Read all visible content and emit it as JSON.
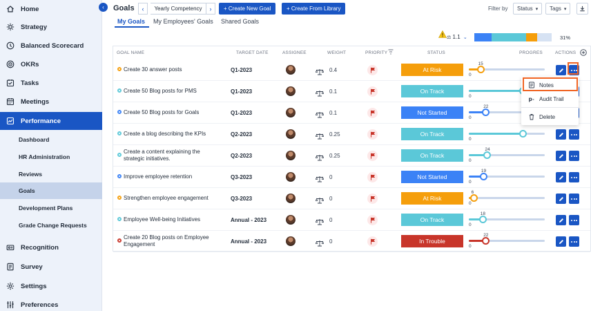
{
  "sidebar": {
    "items": [
      {
        "label": "Home",
        "icon": "home-icon"
      },
      {
        "label": "Strategy",
        "icon": "strategy-icon"
      },
      {
        "label": "Balanced Scorecard",
        "icon": "scorecard-icon"
      },
      {
        "label": "OKRs",
        "icon": "target-icon"
      },
      {
        "label": "Tasks",
        "icon": "tasks-icon"
      },
      {
        "label": "Meetings",
        "icon": "calendar-icon"
      },
      {
        "label": "Performance",
        "icon": "chart-icon"
      }
    ],
    "sub_items": [
      "Dashboard",
      "HR Administration",
      "Reviews",
      "Goals",
      "Development Plans",
      "Grade Change Requests"
    ],
    "bottom_items": [
      {
        "label": "Recognition",
        "icon": "recognition-icon"
      },
      {
        "label": "Survey",
        "icon": "survey-icon"
      },
      {
        "label": "Settings",
        "icon": "gear-icon"
      },
      {
        "label": "Preferences",
        "icon": "sliders-icon"
      }
    ]
  },
  "header": {
    "title": "Goals",
    "competency": "Yearly Competency",
    "create_new": "+ Create New Goal",
    "create_library": "+ Create From Library",
    "filter_by": "Filter by",
    "status_filter": "Status",
    "tags_filter": "Tags"
  },
  "tabs": [
    "My Goals",
    "My Employees' Goals",
    "Shared Goals"
  ],
  "summary": {
    "value": "1.1",
    "percent": "31%",
    "segments": [
      {
        "color": "#3b82f6",
        "fraction": 0.22
      },
      {
        "color": "#5bc8d8",
        "fraction": 0.45
      },
      {
        "color": "#f59e0b",
        "fraction": 0.14
      },
      {
        "color": "#d6e2f3",
        "fraction": 0.19
      }
    ]
  },
  "columns": [
    "GOAL NAME",
    "TARGET DATE",
    "ASSIGNEE",
    "WEIGHT",
    "PRIORITY",
    "STATUS",
    "PROGRESS",
    "ACTIONS"
  ],
  "colors": {
    "at_risk": "#f59e0b",
    "on_track": "#5bc8d8",
    "not_started": "#3b82f6",
    "in_trouble": "#c8352a",
    "accent": "#1a56c4",
    "highlight": "#f06423"
  },
  "rows": [
    {
      "name": "Create 30 answer posts",
      "target": "Q1-2023",
      "weight": "0.4",
      "status": "At Risk",
      "status_key": "at_risk",
      "progress": 15,
      "progress_label": "15",
      "dot": "#f59e0b"
    },
    {
      "name": "Create 50 Blog posts for PMS",
      "target": "Q1-2023",
      "weight": "0.1",
      "status": "On Track",
      "status_key": "on_track",
      "progress": 71,
      "progress_label": "",
      "dot": "#5bc8d8"
    },
    {
      "name": "Create 50 Blog posts for Goals",
      "target": "Q1-2023",
      "weight": "0.1",
      "status": "Not Started",
      "status_key": "not_started",
      "progress": 22,
      "progress_label": "22",
      "dot": "#3b82f6"
    },
    {
      "name": "Create a blog describing the KPIs",
      "target": "Q2-2023",
      "weight": "0.25",
      "status": "On Track",
      "status_key": "on_track",
      "progress": 71,
      "progress_label": "",
      "dot": "#5bc8d8"
    },
    {
      "name": "Create a content explaining the strategic initiatives.",
      "target": "Q2-2023",
      "weight": "0.25",
      "status": "On Track",
      "status_key": "on_track",
      "progress": 24,
      "progress_label": "24",
      "dot": "#5bc8d8"
    },
    {
      "name": "Improve employee retention",
      "target": "Q3-2023",
      "weight": "0",
      "status": "Not Started",
      "status_key": "not_started",
      "progress": 19,
      "progress_label": "19",
      "dot": "#3b82f6"
    },
    {
      "name": "Strengthen employee engagement",
      "target": "Q3-2023",
      "weight": "0",
      "status": "At Risk",
      "status_key": "at_risk",
      "progress": 6,
      "progress_label": "6",
      "dot": "#f59e0b"
    },
    {
      "name": "Employee Well-being Initiatives",
      "target": "Annual - 2023",
      "weight": "0",
      "status": "On Track",
      "status_key": "on_track",
      "progress": 18,
      "progress_label": "18",
      "dot": "#5bc8d8"
    },
    {
      "name": "Create 20 Blog posts on Employee Engagement",
      "target": "Annual - 2023",
      "weight": "0",
      "status": "In Trouble",
      "status_key": "in_trouble",
      "progress": 22,
      "progress_label": "22",
      "dot": "#c8352a"
    }
  ],
  "progress_zero": "0",
  "menu": {
    "items": [
      {
        "label": "Notes",
        "icon": "notes-icon"
      },
      {
        "label": "Audit Trail",
        "icon": "audit-icon"
      },
      {
        "label": "Delete",
        "icon": "trash-icon"
      }
    ]
  }
}
